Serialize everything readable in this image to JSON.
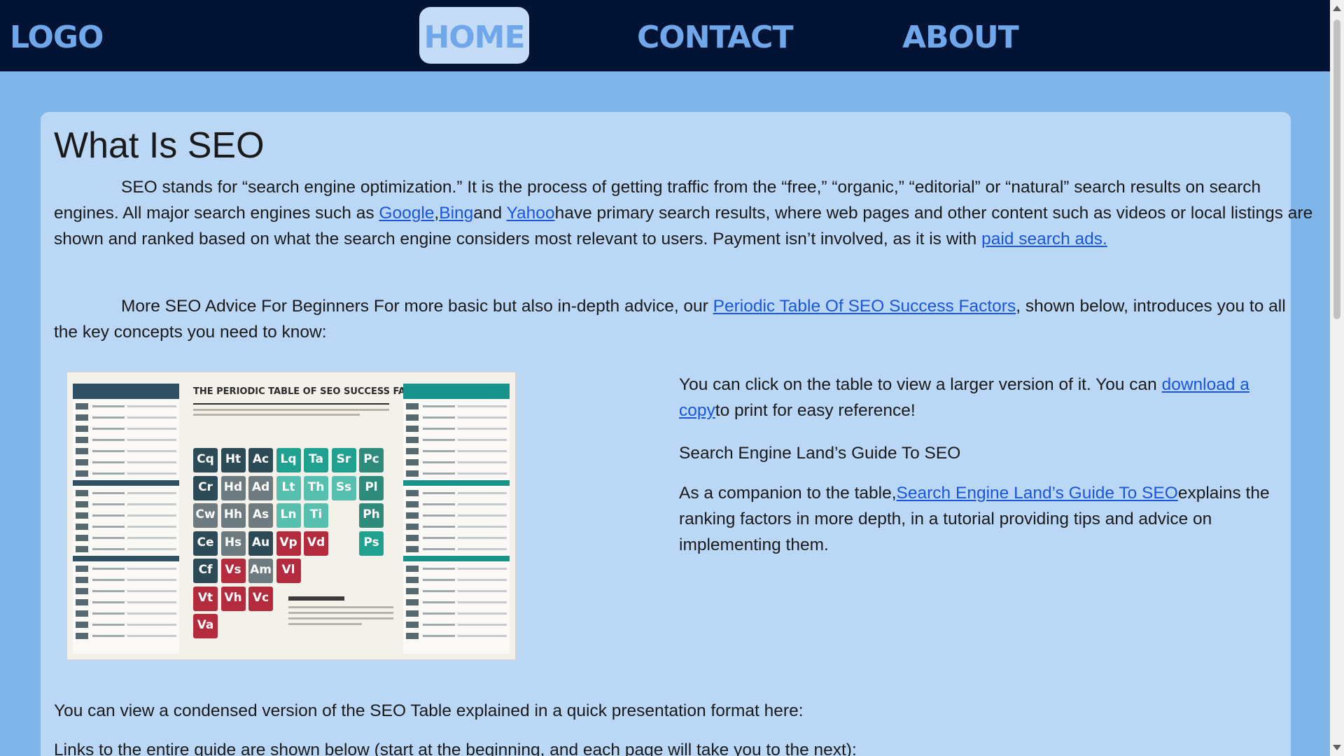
{
  "nav": {
    "logo": "LOGO",
    "home": "HOME",
    "contact": "CONTACT",
    "about": "ABOUT",
    "colors": {
      "bar": "#031333",
      "text": "#6fa7ea",
      "active_bg": "#c5dcf7"
    }
  },
  "content": {
    "title": "What Is SEO",
    "p1": {
      "text_a": "SEO stands for “search engine optimization.” It is the process of getting traffic from the “free,” “organic,” “editorial” or “natural” search results on search engines. All major search engines such as ",
      "link_google": "Google",
      "sep": ",",
      "link_bing": "Bing",
      "text_and": "and ",
      "link_yahoo": "Yahoo",
      "text_b": "have primary search results, where web pages and other content such as videos or local listings are shown and ranked based on what the search engine considers most relevant to users. Payment isn’t involved, as it is with ",
      "link_paid": "paid search ads."
    },
    "p2": {
      "text_a": "More SEO Advice For Beginners For more basic but also in-depth advice, our ",
      "link_table": "Periodic Table Of SEO Success Factors",
      "text_b": ", shown below, introduces you to all the key concepts you need to know:"
    },
    "image": {
      "heading": "THE PERIODIC TABLE OF SEO SUCCESS FACTORS",
      "tiles": [
        "Cq",
        "Ht",
        "Ac",
        "Lq",
        "Ta",
        "Sr",
        "Pc",
        "Cr",
        "Hd",
        "Ad",
        "Lt",
        "Th",
        "Ss",
        "Pl",
        "Cw",
        "Hh",
        "As",
        "Ln",
        "Ti",
        "Ph",
        "Ce",
        "Hs",
        "Au",
        "Vp",
        "Vd",
        "Ps",
        "Cf",
        "Vs",
        "Am",
        "Vl",
        "Vt",
        "Vh",
        "Vc",
        "Va"
      ]
    },
    "side": {
      "s1_text": "You can click on the table to view a larger version of it. You can ",
      "s1_link": "download a copy",
      "s1_tail": "to print for easy reference!",
      "s2": "Search Engine Land’s Guide To SEO",
      "s3_text": "As a companion to the table,",
      "s3_link": "Search Engine Land’s Guide To SEO",
      "s3_tail": "explains the ranking factors in more depth, in a tutorial providing tips and advice on implementing them."
    },
    "p3": "You can view a condensed version of the SEO Table explained in a quick presentation format here:",
    "p4": "Links to the entire guide are shown below (start at the beginning, and each page will take you to the next):"
  },
  "colors": {
    "page_bg": "#80b5e9",
    "card_bg": "#bad7f5",
    "link": "#1a56db"
  }
}
